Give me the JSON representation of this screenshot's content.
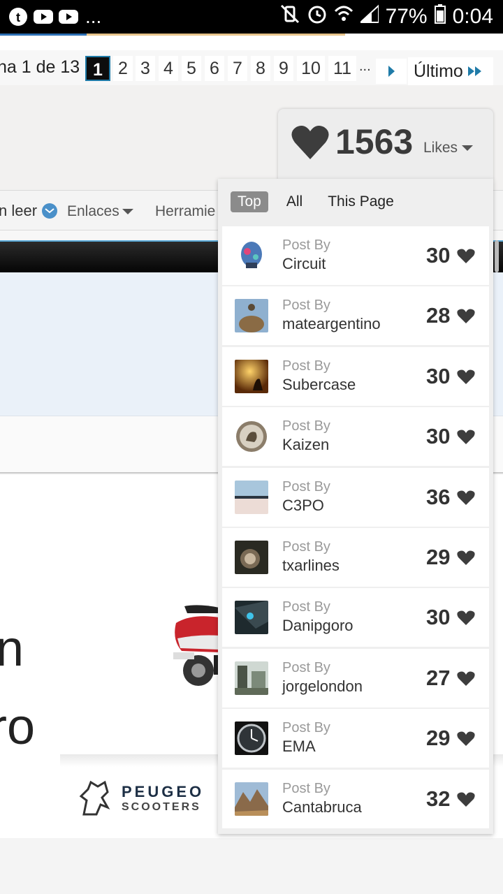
{
  "status_bar": {
    "battery": "77%",
    "time": "0:04",
    "overflow": "...",
    "icons": [
      "tumblr-icon",
      "youtube-icon",
      "youtube-icon",
      "mute-vibrate-icon",
      "alarm-icon",
      "wifi-icon",
      "signal-icon",
      "battery-icon"
    ]
  },
  "pagination": {
    "summary": "na 1 de 13",
    "current": "1",
    "pages": [
      "2",
      "3",
      "4",
      "5",
      "6",
      "7",
      "8",
      "9",
      "10",
      "11"
    ],
    "ellipsis": "...",
    "last_label": "Último"
  },
  "nav": {
    "unread_label": "n leer",
    "links_label": "Enlaces",
    "tools_label": "Herramie"
  },
  "ad": {
    "text_line1": "n",
    "text_line2": "ro",
    "brand": "PEUGEO",
    "brand_sub": "SCOOTERS"
  },
  "likes": {
    "count": "1563",
    "label": "Likes",
    "tabs": [
      "Top",
      "All",
      "This Page"
    ],
    "active_tab": "Top",
    "entries": [
      {
        "prefix": "Post By",
        "user": "Circuit",
        "count": "30"
      },
      {
        "prefix": "Post By",
        "user": "mateargentino",
        "count": "28"
      },
      {
        "prefix": "Post By",
        "user": "Subercase",
        "count": "30"
      },
      {
        "prefix": "Post By",
        "user": "Kaizen",
        "count": "30"
      },
      {
        "prefix": "Post By",
        "user": "C3PO",
        "count": "36"
      },
      {
        "prefix": "Post By",
        "user": "txarlines",
        "count": "29"
      },
      {
        "prefix": "Post By",
        "user": "Danipgoro",
        "count": "30"
      },
      {
        "prefix": "Post By",
        "user": "jorgelondon",
        "count": "27"
      },
      {
        "prefix": "Post By",
        "user": "EMA",
        "count": "29"
      },
      {
        "prefix": "Post By",
        "user": "Cantabruca",
        "count": "32"
      }
    ]
  },
  "colors": {
    "accent": "#1f7ba8",
    "heart": "#3d3d3d",
    "panel": "#efefef"
  }
}
